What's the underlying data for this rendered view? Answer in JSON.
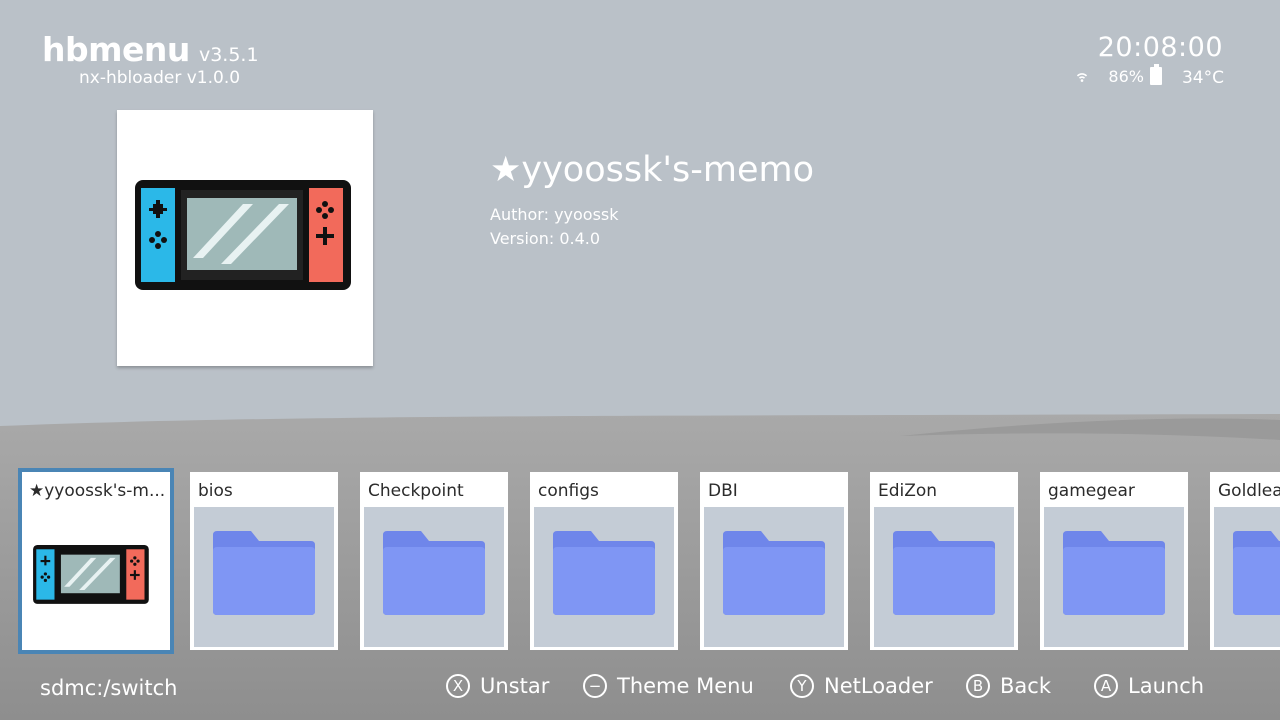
{
  "header": {
    "app_name": "hbmenu",
    "app_version": "v3.5.1",
    "loader": "nx-hbloader v1.0.0",
    "clock": "20:08:00",
    "battery": "86%",
    "temperature": "34°C"
  },
  "selected_app": {
    "title": "★yyoossk's-memo",
    "author": "Author: yyoossk",
    "version": "Version: 0.4.0"
  },
  "tiles": [
    {
      "label": "★yyoossk's-m...",
      "type": "app",
      "icon": "handheld-console-icon"
    },
    {
      "label": "bios",
      "type": "folder",
      "icon": "folder-icon"
    },
    {
      "label": "Checkpoint",
      "type": "folder",
      "icon": "folder-icon"
    },
    {
      "label": "configs",
      "type": "folder",
      "icon": "folder-icon"
    },
    {
      "label": "DBI",
      "type": "folder",
      "icon": "folder-icon"
    },
    {
      "label": "EdiZon",
      "type": "folder",
      "icon": "folder-icon"
    },
    {
      "label": "gamegear",
      "type": "folder",
      "icon": "folder-icon"
    },
    {
      "label": "Goldlea",
      "type": "folder",
      "icon": "folder-icon"
    }
  ],
  "footer": {
    "path": "sdmc:/switch",
    "hints": [
      {
        "button": "X",
        "label": "Unstar"
      },
      {
        "button": "−",
        "label": "Theme Menu"
      },
      {
        "button": "Y",
        "label": "NetLoader"
      },
      {
        "button": "B",
        "label": "Back"
      },
      {
        "button": "A",
        "label": "Launch"
      }
    ]
  },
  "colors": {
    "background": "#bac1c8",
    "ground": "#a4a4a4",
    "folder": "#7f93f0",
    "selection": "#4a85b5",
    "joycon_left": "#2bb8e8",
    "joycon_right": "#f26a5b"
  }
}
